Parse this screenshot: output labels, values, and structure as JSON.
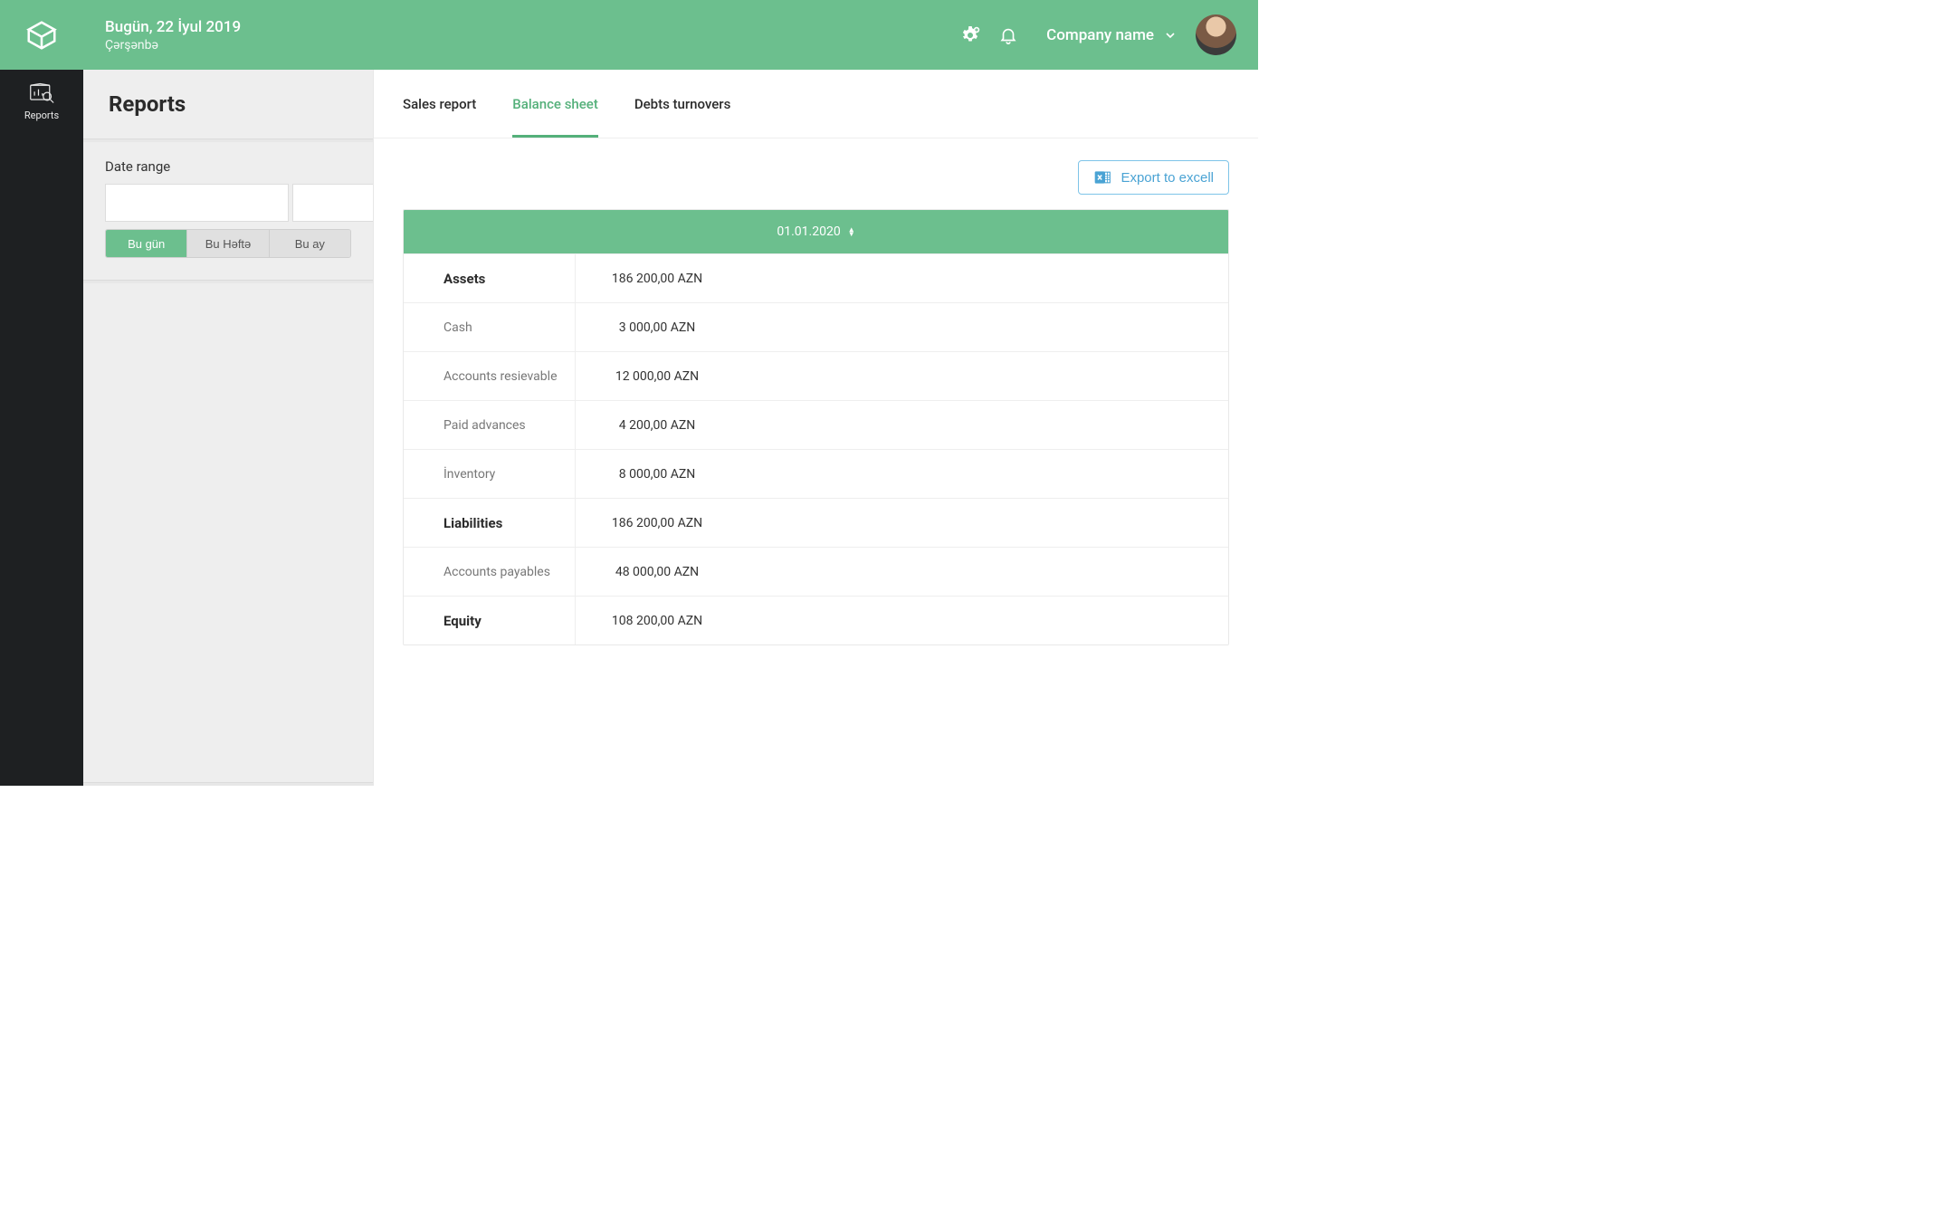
{
  "header": {
    "date_line": "Bugün, 22 İyul 2019",
    "day_line": "Çərşənbə",
    "company_label": "Company name"
  },
  "rail": {
    "reports_label": "Reports"
  },
  "sidepanel": {
    "title": "Reports",
    "date_range_label": "Date range",
    "date_from": "",
    "date_to": "",
    "seg": {
      "today": "Bu gün",
      "week": "Bu Həftə",
      "month": "Bu ay"
    }
  },
  "tabs": {
    "sales": "Sales report",
    "balance": "Balance sheet",
    "debts": "Debts turnovers"
  },
  "toolbar": {
    "export_label": "Export to excell"
  },
  "sheet": {
    "header_date": "01.01.2020",
    "rows": [
      {
        "label": "Assets",
        "value": "186 200,00 AZN",
        "section": true
      },
      {
        "label": "Cash",
        "value": "3 000,00 AZN",
        "section": false
      },
      {
        "label": "Accounts resievable",
        "value": "12 000,00 AZN",
        "section": false
      },
      {
        "label": "Paid advances",
        "value": "4 200,00 AZN",
        "section": false
      },
      {
        "label": "İnventory",
        "value": "8 000,00 AZN",
        "section": false
      },
      {
        "label": "Liabilities",
        "value": "186 200,00 AZN",
        "section": true
      },
      {
        "label": "Accounts payables",
        "value": "48 000,00 AZN",
        "section": false
      },
      {
        "label": "Equity",
        "value": "108 200,00 AZN",
        "section": true
      }
    ]
  }
}
